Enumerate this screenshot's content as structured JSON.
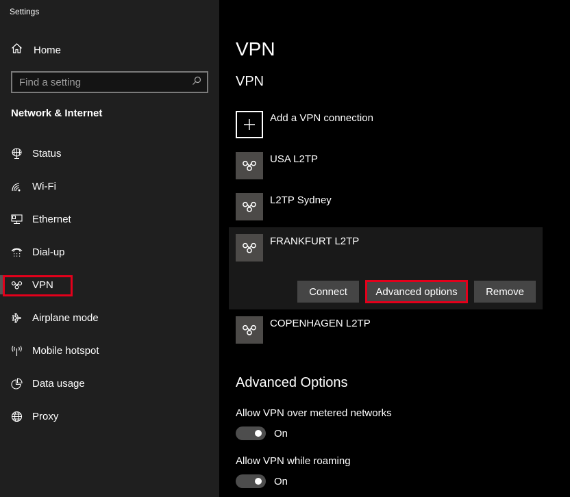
{
  "window": {
    "title": "Settings"
  },
  "sidebar": {
    "home_label": "Home",
    "search": {
      "placeholder": "Find a setting",
      "value": ""
    },
    "section_title": "Network & Internet",
    "items": [
      {
        "label": "Status",
        "icon": "status-globe-icon"
      },
      {
        "label": "Wi-Fi",
        "icon": "wifi-icon"
      },
      {
        "label": "Ethernet",
        "icon": "ethernet-icon"
      },
      {
        "label": "Dial-up",
        "icon": "dialup-phone-icon"
      },
      {
        "label": "VPN",
        "icon": "vpn-icon",
        "selected": true
      },
      {
        "label": "Airplane mode",
        "icon": "airplane-icon"
      },
      {
        "label": "Mobile hotspot",
        "icon": "hotspot-icon"
      },
      {
        "label": "Data usage",
        "icon": "pie-chart-icon"
      },
      {
        "label": "Proxy",
        "icon": "globe-icon"
      }
    ]
  },
  "main": {
    "page_title": "VPN",
    "section_title": "VPN",
    "add_connection_label": "Add a VPN connection",
    "connections": [
      {
        "name": "USA L2TP"
      },
      {
        "name": "L2TP Sydney"
      },
      {
        "name": "FRANKFURT L2TP",
        "expanded": true
      },
      {
        "name": "COPENHAGEN L2TP"
      }
    ],
    "buttons": {
      "connect": "Connect",
      "advanced": "Advanced options",
      "remove": "Remove"
    },
    "advanced": {
      "title": "Advanced Options",
      "options": [
        {
          "label": "Allow VPN over metered networks",
          "state": "On",
          "enabled": true
        },
        {
          "label": "Allow VPN while roaming",
          "state": "On",
          "enabled": true
        }
      ]
    }
  },
  "highlight_color": "#e3001b"
}
